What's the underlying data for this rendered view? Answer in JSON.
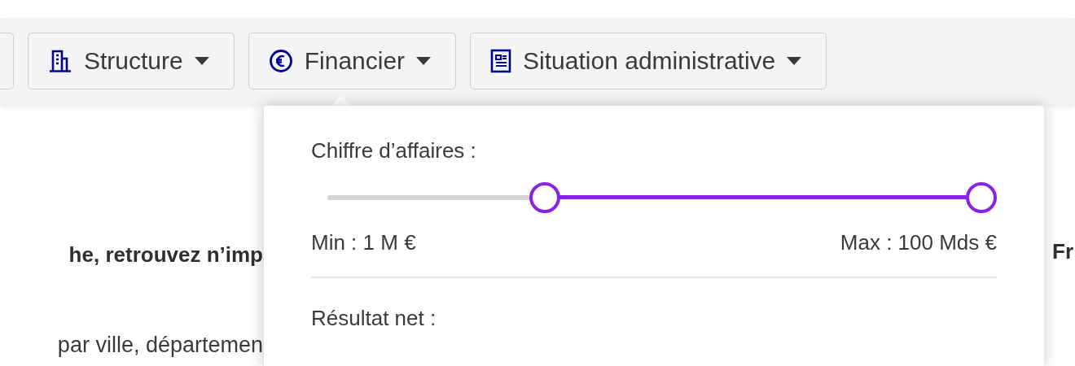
{
  "toolbar": {
    "filters": [
      {
        "label": "Structure",
        "kind": "building",
        "open": false
      },
      {
        "label": "Financier",
        "kind": "euro",
        "open": true
      },
      {
        "label": "Situation administrative",
        "kind": "document",
        "open": false
      }
    ]
  },
  "popover": {
    "range_filters": [
      {
        "label": "Chiffre d’affaires :",
        "low": {
          "level": 0.325
        },
        "high": {
          "level": 0.977
        },
        "min_label": "Min : 1 M €",
        "max_label": "Max : 100 Mds €"
      },
      {
        "label": "Résultat net :"
      }
    ]
  },
  "background": {
    "headline_fragment": "he, retrouvez n’imp",
    "subtitle_fragment": "par ville, départemen",
    "right_fragment": "Fr"
  }
}
